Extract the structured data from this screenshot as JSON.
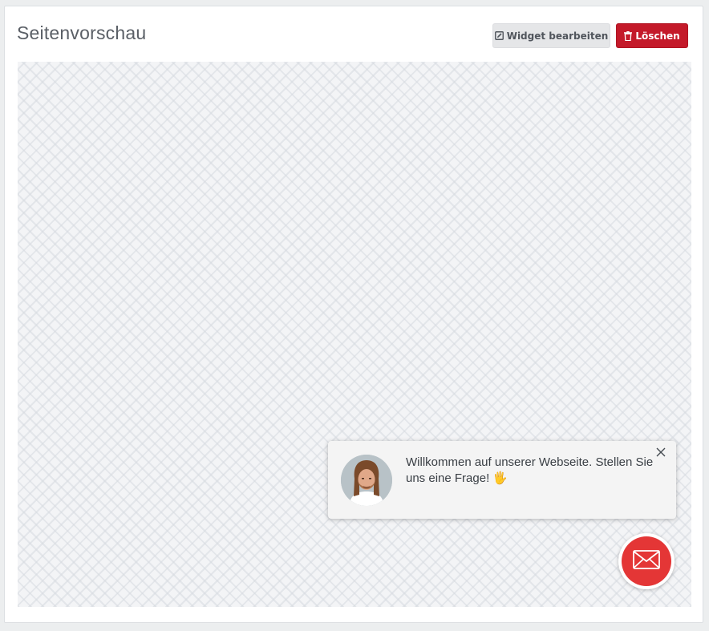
{
  "page": {
    "title": "Seitenvorschau"
  },
  "toolbar": {
    "edit_label": "Widget bearbeiten",
    "edit_icon": "edit-icon",
    "delete_label": "Löschen",
    "delete_icon": "trash-icon"
  },
  "widget": {
    "welcome_message": "Willkommen auf unserer Webseite. Stellen Sie uns eine Frage! 🖐",
    "avatar": "agent-avatar",
    "close_icon": "close-icon",
    "launcher_icon": "envelope-icon",
    "accent_color": "#e43636"
  },
  "colors": {
    "delete_button": "#c41a2a",
    "edit_button": "#e5e6e8",
    "preview_background": "#f3f4f6"
  }
}
